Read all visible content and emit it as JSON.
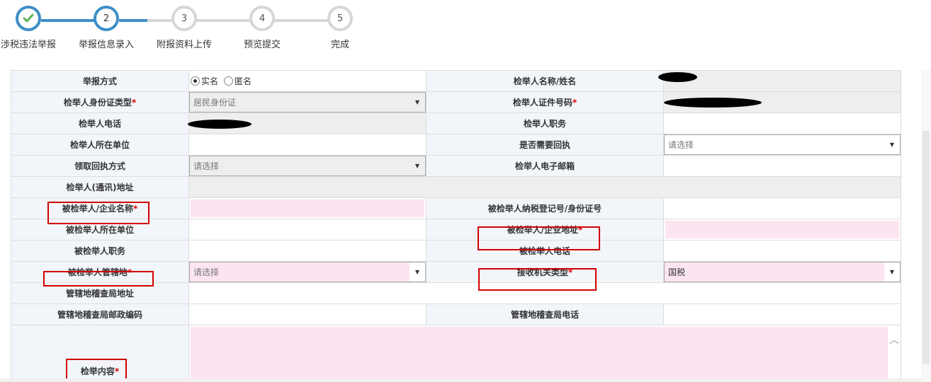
{
  "stepper": {
    "steps": [
      {
        "num": "✔",
        "label": "涉税违法举报",
        "state": "done"
      },
      {
        "num": "2",
        "label": "举报信息录入",
        "state": "active"
      },
      {
        "num": "3",
        "label": "附报资料上传",
        "state": "todo"
      },
      {
        "num": "4",
        "label": "预览提交",
        "state": "todo"
      },
      {
        "num": "5",
        "label": "完成",
        "state": "todo"
      }
    ]
  },
  "form": {
    "report_method_label": "举报方式",
    "real_name": "实名",
    "anonymous": "匿名",
    "informant_name_label": "检举人名称/姓名",
    "id_type_label": "检举人身份证类型",
    "id_type_value": "居民身份证",
    "id_number_label": "检举人证件号码",
    "phone_label": "检举人电话",
    "position_label": "检举人职务",
    "workplace_label": "检举人所在单位",
    "need_receipt_label": "是否需要回执",
    "need_receipt_placeholder": "请选择",
    "receipt_method_label": "领取回执方式",
    "receipt_method_placeholder": "请选择",
    "email_label": "检举人电子邮箱",
    "address_label": "检举人(通讯)地址",
    "accused_name_label": "被检举人/企业名称",
    "accused_taxid_label": "被检举人纳税登记号/身份证号",
    "accused_workplace_label": "被检举人所在单位",
    "accused_address_label": "被检举人/企业地址",
    "accused_position_label": "被检举人职务",
    "accused_phone_label": "被检举人电话",
    "jurisdiction_label": "被检举人管辖地",
    "jurisdiction_placeholder": "请选择",
    "agency_type_label": "接收机关类型",
    "agency_type_value": "国税",
    "bureau_address_label": "管辖地稽查局地址",
    "bureau_postcode_label": "管辖地稽查局邮政编码",
    "bureau_phone_label": "管辖地稽查局电话",
    "content_label": "检举内容",
    "required_mark": "*"
  },
  "colors": {
    "accent": "#3d8fc6",
    "required": "#e00000",
    "highlight_box": "#d20000",
    "required_field_bg": "#fce4f0",
    "label_bg": "#f2f6fa"
  }
}
